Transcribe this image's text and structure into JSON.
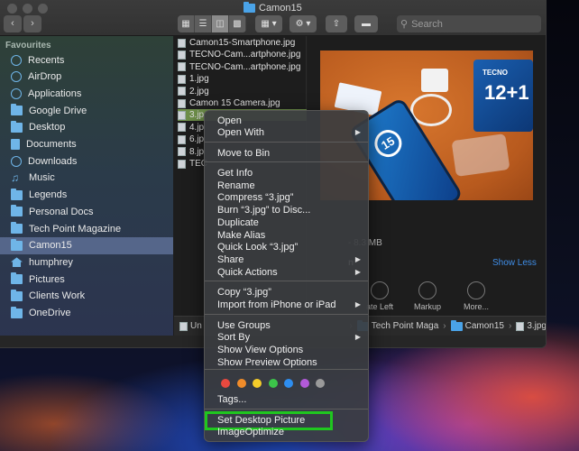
{
  "window": {
    "title": "Camon15"
  },
  "toolbar": {
    "search_placeholder": "Search"
  },
  "sidebar": {
    "heading": "Favourites",
    "items": [
      {
        "label": "Recents",
        "icon": "clock-icon"
      },
      {
        "label": "AirDrop",
        "icon": "airdrop-icon"
      },
      {
        "label": "Applications",
        "icon": "applications-icon"
      },
      {
        "label": "Google Drive",
        "icon": "folder-icon"
      },
      {
        "label": "Desktop",
        "icon": "desktop-icon"
      },
      {
        "label": "Documents",
        "icon": "document-icon"
      },
      {
        "label": "Downloads",
        "icon": "download-icon"
      },
      {
        "label": "Music",
        "icon": "music-icon"
      },
      {
        "label": "Legends",
        "icon": "folder-icon"
      },
      {
        "label": "Personal Docs",
        "icon": "folder-icon"
      },
      {
        "label": "Tech Point Magazine",
        "icon": "folder-icon"
      },
      {
        "label": "Camon15",
        "icon": "folder-icon",
        "selected": true
      },
      {
        "label": "humphrey",
        "icon": "home-icon"
      },
      {
        "label": "Pictures",
        "icon": "pictures-icon"
      },
      {
        "label": "Clients Work",
        "icon": "folder-icon"
      },
      {
        "label": "OneDrive",
        "icon": "folder-icon"
      }
    ]
  },
  "files": [
    "Camon15-Smartphone.jpg",
    "TECNO-Cam...artphone.jpg",
    "TECNO-Cam...artphone.jpg",
    "1.jpg",
    "2.jpg",
    "Camon 15 Camera.jpg",
    "3.jp",
    "4.jp",
    "6.jp",
    "8.jp",
    "TEC"
  ],
  "preview": {
    "size": "8.3 MB",
    "show_less": "Show Less",
    "actions": [
      "ate Left",
      "Markup",
      "More..."
    ],
    "photo_text": {
      "box_number": "12+1",
      "box_brand": "TECNO",
      "phone_number": "15"
    }
  },
  "pathbar": [
    "Un",
    "Tech Point Maga",
    "Camon15",
    "3.jpg"
  ],
  "context_menu": {
    "items": [
      {
        "label": "Open"
      },
      {
        "label": "Open With",
        "submenu": true
      },
      {
        "label": "Move to Bin"
      },
      {
        "label": "Get Info"
      },
      {
        "label": "Rename"
      },
      {
        "label": "Compress “3.jpg”"
      },
      {
        "label": "Burn “3.jpg” to Disc..."
      },
      {
        "label": "Duplicate"
      },
      {
        "label": "Make Alias"
      },
      {
        "label": "Quick Look “3.jpg”"
      },
      {
        "label": "Share",
        "submenu": true
      },
      {
        "label": "Quick Actions",
        "submenu": true
      },
      {
        "label": "Copy “3.jpg”"
      },
      {
        "label": "Import from iPhone or iPad",
        "submenu": true
      },
      {
        "label": "Use Groups"
      },
      {
        "label": "Sort By",
        "submenu": true
      },
      {
        "label": "Show View Options"
      },
      {
        "label": "Show Preview Options"
      },
      {
        "label": "Tags..."
      },
      {
        "label": "Set Desktop Picture",
        "highlighted": true
      },
      {
        "label": "ImageOptimize"
      }
    ],
    "tag_colors": [
      "#e8493f",
      "#f08c2a",
      "#f4cc2a",
      "#3cc44a",
      "#2e8ef0",
      "#b25ad8",
      "#9a9a9a"
    ]
  }
}
